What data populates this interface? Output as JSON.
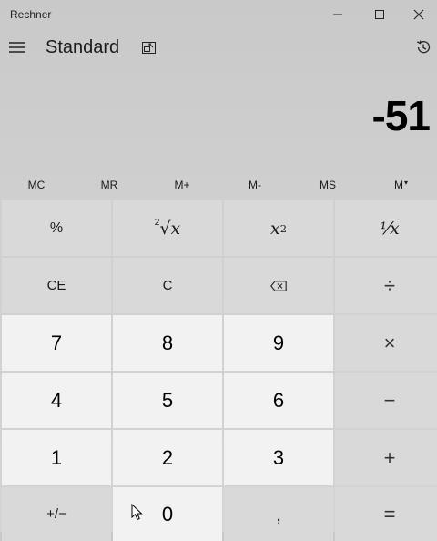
{
  "window": {
    "title": "Rechner"
  },
  "header": {
    "mode": "Standard"
  },
  "display": {
    "value": "-51"
  },
  "memory": {
    "mc": "MC",
    "mr": "MR",
    "mplus": "M+",
    "mminus": "M-",
    "ms": "MS",
    "mview": "M"
  },
  "keys": {
    "percent": "%",
    "sqrt_index": "2",
    "sqrt_x": "x",
    "square_x": "x",
    "square_exp": "2",
    "reciprocal": "⅟x",
    "ce": "CE",
    "c": "C",
    "divide": "÷",
    "seven": "7",
    "eight": "8",
    "nine": "9",
    "multiply": "×",
    "four": "4",
    "five": "5",
    "six": "6",
    "minus": "−",
    "one": "1",
    "two": "2",
    "three": "3",
    "plus": "+",
    "negate": "+/−",
    "zero": "0",
    "decimal": ",",
    "equals": "="
  },
  "colors": {
    "number_key_bg": "#f2f2f2",
    "function_key_bg": "#d9d9d9",
    "window_bg": "#c9c9c9"
  }
}
